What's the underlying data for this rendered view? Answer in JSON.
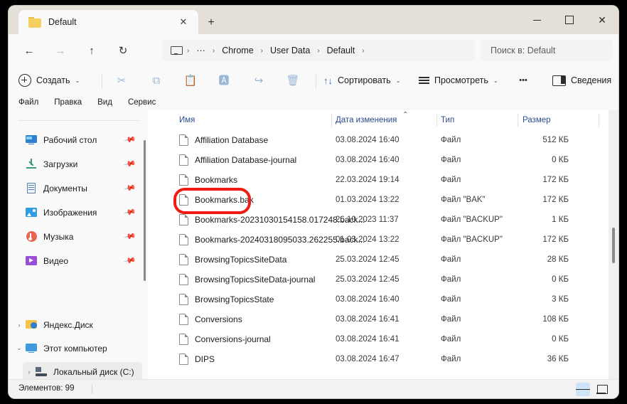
{
  "window": {
    "tab_title": "Default",
    "tab_close_label": "✕",
    "new_tab_label": "+",
    "minimize_label": "",
    "maximize_label": "",
    "close_label": "✕"
  },
  "nav": {
    "back": "←",
    "forward": "→",
    "up": "↑",
    "refresh": "↻",
    "breadcrumbs": [
      "Chrome",
      "User Data",
      "Default"
    ],
    "overflow": "···",
    "separator": "›",
    "pc_icon": "monitor-icon"
  },
  "search": {
    "placeholder": "Поиск в: Default"
  },
  "toolbar": {
    "new_label": "Создать",
    "cut_label": "✂",
    "copy_label": "⧉",
    "paste_label": "📋",
    "rename_label": "🅰",
    "share_label": "↪",
    "delete_label": "🗑",
    "sort_label": "Сортировать",
    "sort_icon": "↑↓",
    "view_label": "Просмотреть",
    "more_label": "•••",
    "details_label": "Сведения",
    "chevron": "⌄"
  },
  "menubar": {
    "items": [
      "Файл",
      "Правка",
      "Вид",
      "Сервис"
    ]
  },
  "sidebar": {
    "quick": [
      {
        "label": "Рабочий стол",
        "icon": "desktop-icon",
        "pinned": true
      },
      {
        "label": "Загрузки",
        "icon": "downloads-icon",
        "pinned": true
      },
      {
        "label": "Документы",
        "icon": "documents-icon",
        "pinned": true
      },
      {
        "label": "Изображения",
        "icon": "pictures-icon",
        "pinned": true
      },
      {
        "label": "Музыка",
        "icon": "music-icon",
        "pinned": true
      },
      {
        "label": "Видео",
        "icon": "videos-icon",
        "pinned": true
      }
    ],
    "tree": [
      {
        "label": "Яндекс.Диск",
        "icon": "yandex-disk-icon",
        "caret": "›",
        "selected": false
      },
      {
        "label": "Этот компьютер",
        "icon": "this-pc-icon",
        "caret": "⌄",
        "selected": false
      },
      {
        "label": "Локальный диск (C:)",
        "icon": "hard-drive-icon",
        "caret": "›",
        "selected": true
      }
    ],
    "pin_glyph": "📌"
  },
  "filelist": {
    "columns": [
      {
        "label": "Имя"
      },
      {
        "label": "Дата изменения"
      },
      {
        "label": "Тип"
      },
      {
        "label": "Размер"
      }
    ],
    "sort_caret": "⌃",
    "rows": [
      {
        "name": "Affiliation Database",
        "date": "03.08.2024 16:40",
        "type": "Файл",
        "size": "512 КБ"
      },
      {
        "name": "Affiliation Database-journal",
        "date": "03.08.2024 16:40",
        "type": "Файл",
        "size": "0 КБ"
      },
      {
        "name": "Bookmarks",
        "date": "22.03.2024 19:14",
        "type": "Файл",
        "size": "172 КБ"
      },
      {
        "name": "Bookmarks.bak",
        "date": "01.03.2024 13:22",
        "type": "Файл \"BAK\"",
        "size": "172 КБ"
      },
      {
        "name": "Bookmarks-20231030154158.017248.back...",
        "date": "26.10.2023 11:37",
        "type": "Файл \"BACKUP\"",
        "size": "1 КБ"
      },
      {
        "name": "Bookmarks-20240318095033.262255.back...",
        "date": "01.03.2024 13:22",
        "type": "Файл \"BACKUP\"",
        "size": "172 КБ"
      },
      {
        "name": "BrowsingTopicsSiteData",
        "date": "25.03.2024 12:45",
        "type": "Файл",
        "size": "28 КБ"
      },
      {
        "name": "BrowsingTopicsSiteData-journal",
        "date": "25.03.2024 12:45",
        "type": "Файл",
        "size": "0 КБ"
      },
      {
        "name": "BrowsingTopicsState",
        "date": "03.08.2024 16:40",
        "type": "Файл",
        "size": "3 КБ"
      },
      {
        "name": "Conversions",
        "date": "03.08.2024 16:41",
        "type": "Файл",
        "size": "108 КБ"
      },
      {
        "name": "Conversions-journal",
        "date": "03.08.2024 16:41",
        "type": "Файл",
        "size": "0 КБ"
      },
      {
        "name": "DIPS",
        "date": "03.08.2024 16:47",
        "type": "Файл",
        "size": "36 КБ"
      }
    ]
  },
  "annotation": {
    "target": "Bookmarks",
    "color": "#ef1c15"
  },
  "status": {
    "items_label": "Элементов: 99",
    "view_list_icon": "list-view-icon",
    "view_tiles_icon": "tile-view-icon"
  }
}
